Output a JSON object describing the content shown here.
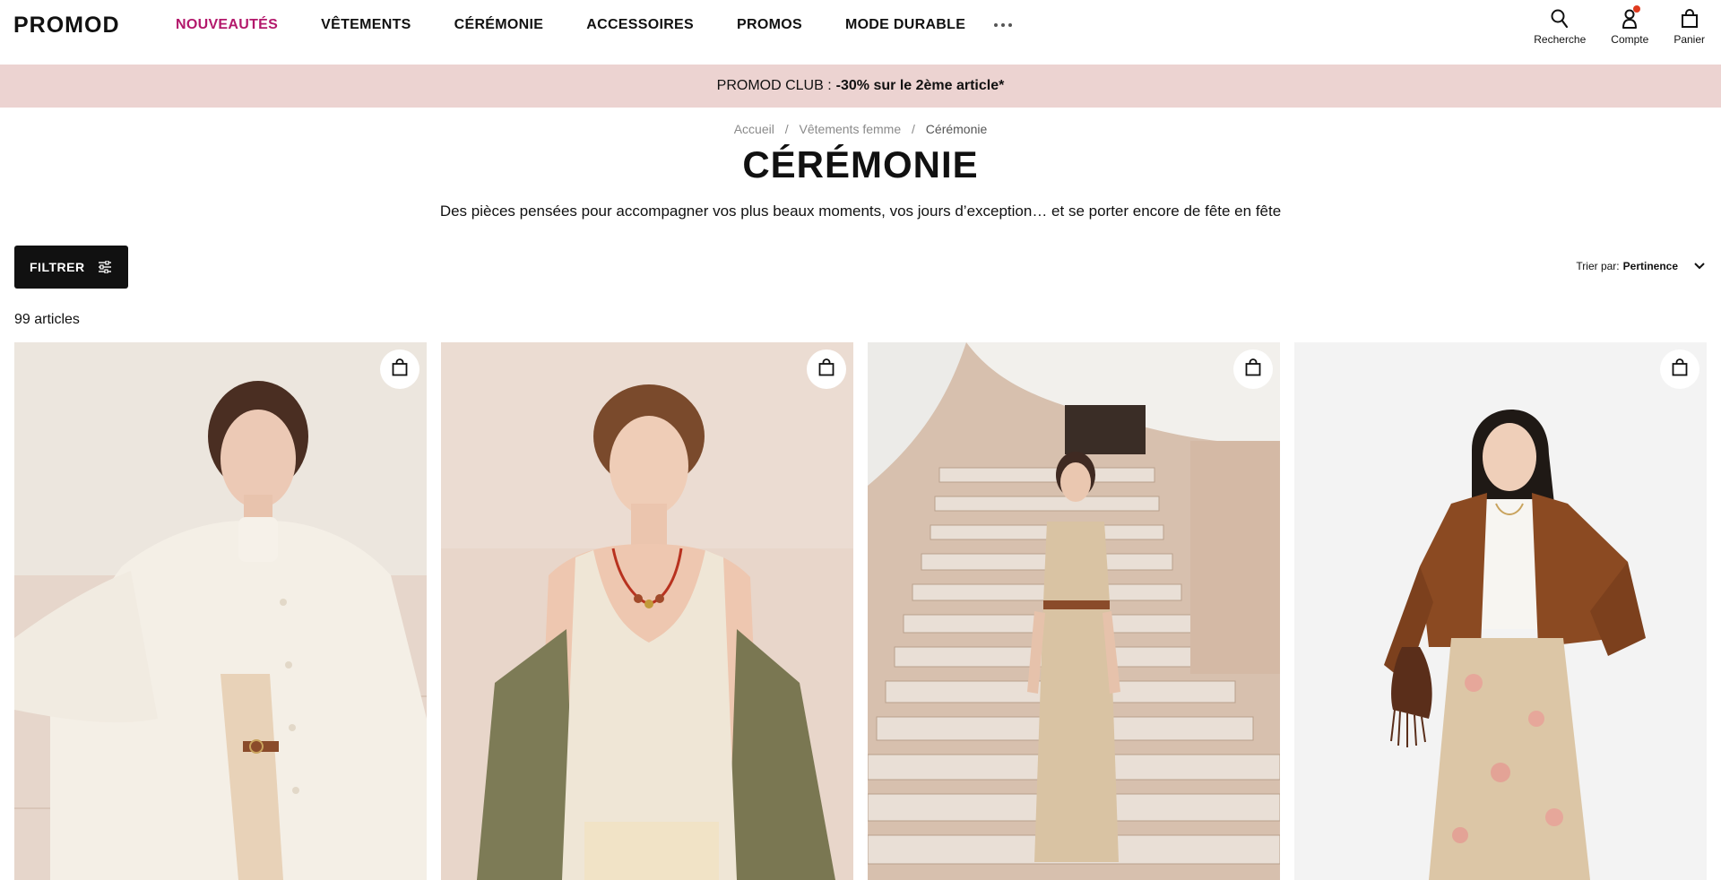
{
  "header": {
    "logo": "PROMOD",
    "nav": [
      {
        "label": "NOUVEAUTÉS",
        "active": true
      },
      {
        "label": "VÊTEMENTS",
        "active": false
      },
      {
        "label": "CÉRÉMONIE",
        "active": false
      },
      {
        "label": "ACCESSOIRES",
        "active": false
      },
      {
        "label": "PROMOS",
        "active": false
      },
      {
        "label": "MODE DURABLE",
        "active": false
      }
    ],
    "icons": {
      "search_label": "Recherche",
      "account_label": "Compte",
      "cart_label": "Panier"
    }
  },
  "promo": {
    "prefix": "PROMOD CLUB :",
    "highlight": "-30% sur le 2ème article*"
  },
  "breadcrumb": {
    "items": [
      "Accueil",
      "Vêtements femme",
      "Cérémonie"
    ],
    "separator": "/"
  },
  "page": {
    "title": "CÉRÉMONIE",
    "description": "Des pièces pensées pour accompagner vos plus beaux moments, vos jours d’exception… et se porter encore de fête en fête"
  },
  "toolbar": {
    "filter_label": "FILTRER",
    "sort_prefix": "Trier par:",
    "sort_value": "Pertinence",
    "count_label": "99 articles"
  },
  "colors": {
    "accent": "#b3186b",
    "promo_bg": "#ecd3d1",
    "notification": "#e03a1e"
  },
  "products": [
    {
      "image_desc": "cream blouse",
      "icon": "shopping-bag-icon"
    },
    {
      "image_desc": "ivory tank top with olive jacket",
      "icon": "shopping-bag-icon"
    },
    {
      "image_desc": "floral strapless jumpsuit on stairs",
      "icon": "shopping-bag-icon"
    },
    {
      "image_desc": "brown suede jacket with floral trousers",
      "icon": "shopping-bag-icon"
    }
  ]
}
